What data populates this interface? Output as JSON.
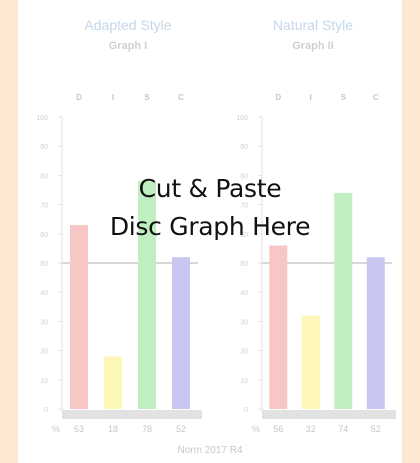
{
  "overlay": {
    "line1": "Cut & Paste",
    "line2": "Disc Graph Here"
  },
  "footer": "Norm 2017 R4",
  "colors": {
    "D": "#e53935",
    "I": "#f5e400",
    "S": "#22c422",
    "C": "#3b3bd4",
    "title": "#2f6fb3",
    "background": "#fde8d4"
  },
  "chart_data": [
    {
      "type": "bar",
      "title": "Adapted Style",
      "subtitle": "Graph I",
      "categories": [
        "D",
        "I",
        "S",
        "C"
      ],
      "values": [
        63,
        18,
        78,
        52
      ],
      "value_row_label": "%",
      "ylim": [
        0,
        100
      ],
      "yticks": [
        0,
        10,
        20,
        30,
        40,
        50,
        60,
        70,
        80,
        90,
        100
      ],
      "midline": 50,
      "grid": false
    },
    {
      "type": "bar",
      "title": "Natural Style",
      "subtitle": "Graph II",
      "categories": [
        "D",
        "I",
        "S",
        "C"
      ],
      "values": [
        56,
        32,
        74,
        52
      ],
      "value_row_label": "%",
      "ylim": [
        0,
        100
      ],
      "yticks": [
        0,
        10,
        20,
        30,
        40,
        50,
        60,
        70,
        80,
        90,
        100
      ],
      "midline": 50,
      "grid": false
    }
  ]
}
